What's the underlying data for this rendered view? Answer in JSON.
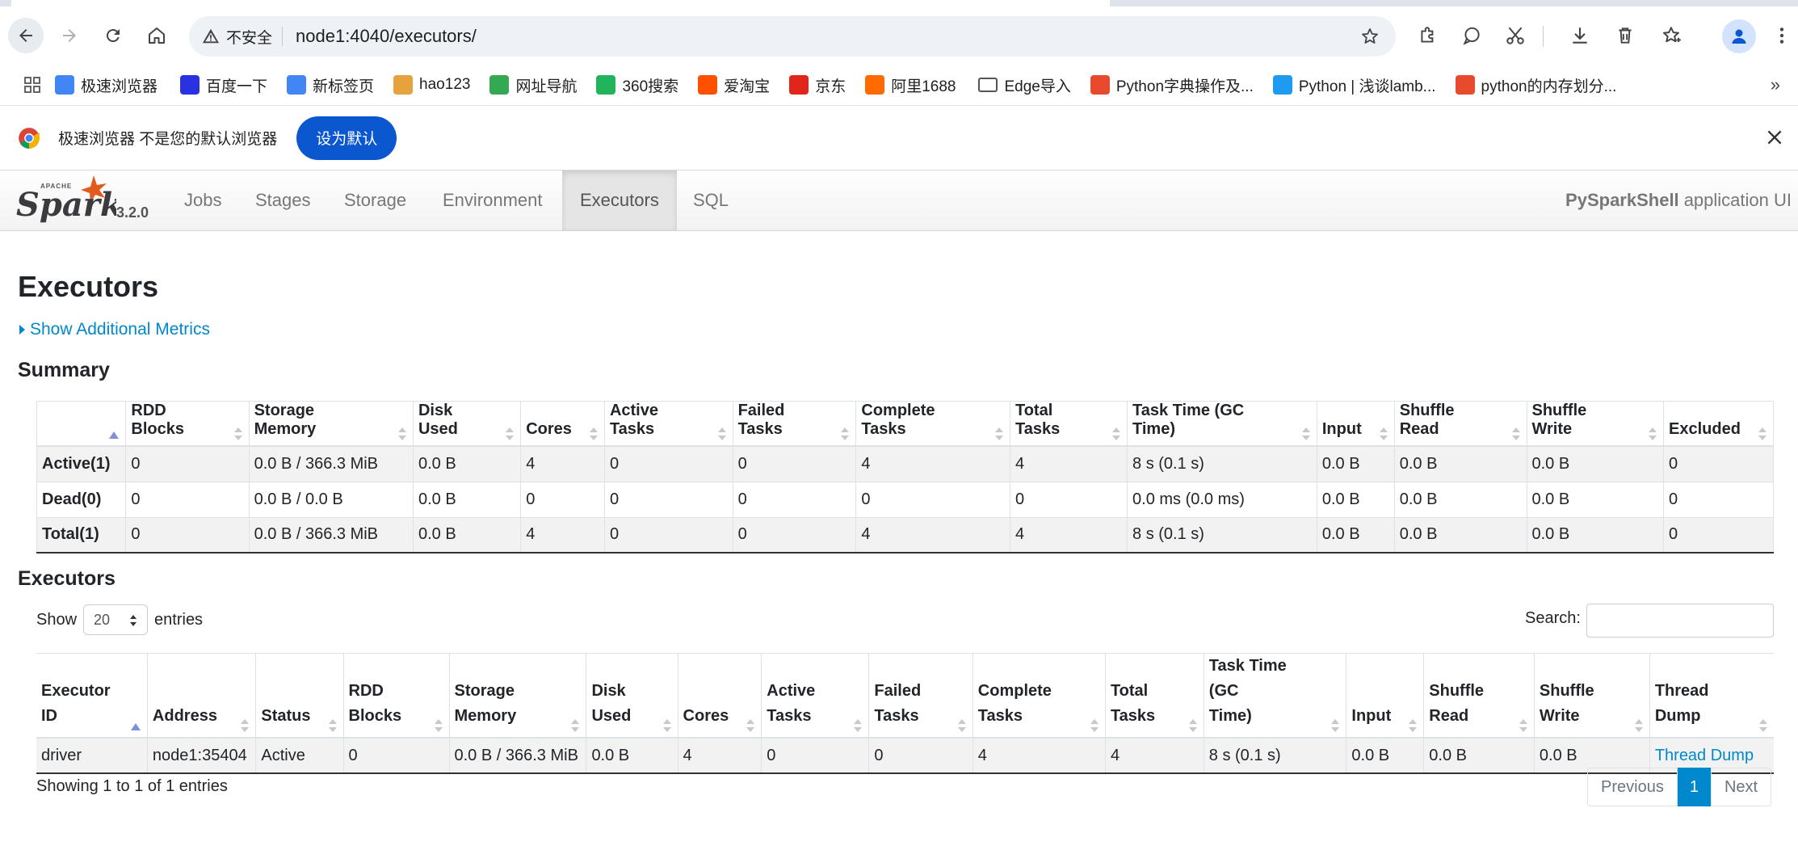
{
  "browser": {
    "insecure_label": "不安全",
    "url": "node1:4040/executors/",
    "bookmarks": [
      {
        "label": "极速浏览器",
        "color": "#4285f4"
      },
      {
        "label": "百度一下",
        "color": "#2932e1"
      },
      {
        "label": "新标签页",
        "color": "#4285f4"
      },
      {
        "label": "hao123",
        "color": "#e6a23c"
      },
      {
        "label": "网址导航",
        "color": "#34a853"
      },
      {
        "label": "360搜索",
        "color": "#21b45b"
      },
      {
        "label": "爱淘宝",
        "color": "#ff5000"
      },
      {
        "label": "京东",
        "color": "#e1251b"
      },
      {
        "label": "阿里1688",
        "color": "#ff6a00"
      },
      {
        "label": "Edge导入",
        "color": "#555555"
      },
      {
        "label": "Python字典操作及...",
        "color": "#e84a2e"
      },
      {
        "label": "Python | 浅谈lamb...",
        "color": "#1e9af0"
      },
      {
        "label": "python的内存划分...",
        "color": "#e84a2e"
      }
    ],
    "infobar": {
      "message": "极速浏览器 不是您的默认浏览器",
      "button": "设为默认"
    }
  },
  "spark": {
    "version": "3.2.0",
    "tabs": [
      "Jobs",
      "Stages",
      "Storage",
      "Environment",
      "Executors",
      "SQL"
    ],
    "active_tab": "Executors",
    "app_name": "PySparkShell",
    "app_suffix": "application UI"
  },
  "page": {
    "title": "Executors",
    "show_metrics": "Show Additional Metrics",
    "summary_heading": "Summary",
    "executors_heading": "Executors"
  },
  "summary": {
    "columns": [
      "",
      "RDD Blocks",
      "Storage Memory",
      "Disk Used",
      "Cores",
      "Active Tasks",
      "Failed Tasks",
      "Complete Tasks",
      "Total Tasks",
      "Task Time (GC Time)",
      "Input",
      "Shuffle Read",
      "Shuffle Write",
      "Excluded"
    ],
    "rows": [
      [
        "Active(1)",
        "0",
        "0.0 B / 366.3 MiB",
        "0.0 B",
        "4",
        "0",
        "0",
        "4",
        "4",
        "8 s (0.1 s)",
        "0.0 B",
        "0.0 B",
        "0.0 B",
        "0"
      ],
      [
        "Dead(0)",
        "0",
        "0.0 B / 0.0 B",
        "0.0 B",
        "0",
        "0",
        "0",
        "0",
        "0",
        "0.0 ms (0.0 ms)",
        "0.0 B",
        "0.0 B",
        "0.0 B",
        "0"
      ],
      [
        "Total(1)",
        "0",
        "0.0 B / 366.3 MiB",
        "0.0 B",
        "4",
        "0",
        "0",
        "4",
        "4",
        "8 s (0.1 s)",
        "0.0 B",
        "0.0 B",
        "0.0 B",
        "0"
      ]
    ]
  },
  "controls": {
    "show_label": "Show",
    "entries_value": "20",
    "entries_label": "entries",
    "search_label": "Search:"
  },
  "executors": {
    "columns": [
      [
        "Executor",
        "ID"
      ],
      [
        "",
        "Address"
      ],
      [
        "",
        "Status"
      ],
      [
        "RDD",
        "Blocks"
      ],
      [
        "Storage",
        "Memory"
      ],
      [
        "Disk",
        "Used"
      ],
      [
        "",
        "Cores"
      ],
      [
        "Active",
        "Tasks"
      ],
      [
        "Failed",
        "Tasks"
      ],
      [
        "Complete",
        "Tasks"
      ],
      [
        "Total",
        "Tasks"
      ],
      [
        "Task Time (GC",
        "Time)"
      ],
      [
        "",
        "Input"
      ],
      [
        "Shuffle",
        "Read"
      ],
      [
        "Shuffle",
        "Write"
      ],
      [
        "Thread",
        "Dump"
      ]
    ],
    "rows": [
      [
        "driver",
        "node1:35404",
        "Active",
        "0",
        "0.0 B / 366.3 MiB",
        "0.0 B",
        "4",
        "0",
        "0",
        "4",
        "4",
        "8 s (0.1 s)",
        "0.0 B",
        "0.0 B",
        "0.0 B",
        "Thread Dump"
      ]
    ]
  },
  "footer": {
    "showing": "Showing 1 to 1 of 1 entries",
    "previous": "Previous",
    "page": "1",
    "next": "Next"
  }
}
